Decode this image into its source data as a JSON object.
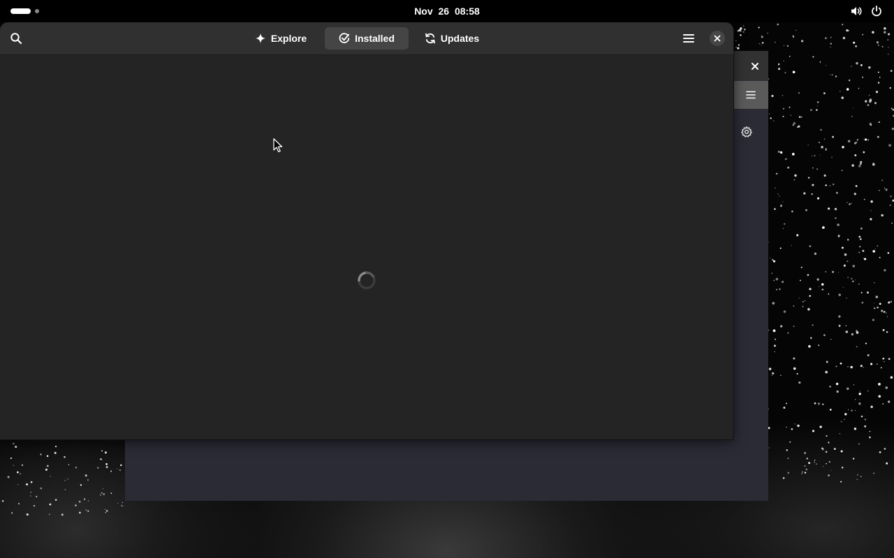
{
  "topbar": {
    "clock": "Nov 26  08:58",
    "icons": [
      "workspace-indicator",
      "volume-icon",
      "power-icon"
    ]
  },
  "app": {
    "tabs": [
      {
        "label": "Explore",
        "icon": "sparkle-icon",
        "active": false
      },
      {
        "label": "Installed",
        "icon": "check-circle-icon",
        "active": true
      },
      {
        "label": "Updates",
        "icon": "refresh-icon",
        "active": false
      }
    ],
    "header_icons": [
      "search-icon",
      "hamburger-menu-icon",
      "close-icon"
    ],
    "state": "loading"
  },
  "background_window": {
    "icons": [
      "close-icon",
      "hamburger-menu-icon",
      "gear-icon"
    ]
  },
  "colors": {
    "window_bg": "#242424",
    "headerbar_bg": "#303030",
    "active_tab_bg": "#454545",
    "topbar_bg": "#000000",
    "back_window_bg": "#2b2b36"
  }
}
